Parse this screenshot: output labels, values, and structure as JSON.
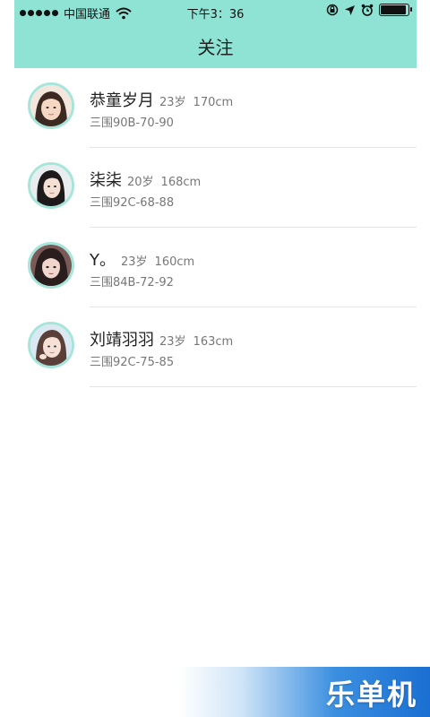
{
  "status_bar": {
    "carrier": "中国联通",
    "time": "下午3：36",
    "battery_level": 0.95
  },
  "header": {
    "title": "关注"
  },
  "follow_list": [
    {
      "name": "恭童岁月",
      "age": "23岁",
      "height": "170cm",
      "measurements": "三围90B-70-90"
    },
    {
      "name": "柒柒",
      "age": "20岁",
      "height": "168cm",
      "measurements": "三围92C-68-88"
    },
    {
      "name": "Y。",
      "age": "23岁",
      "height": "160cm",
      "measurements": "三围84B-72-92"
    },
    {
      "name": "刘靖羽羽",
      "age": "23岁",
      "height": "163cm",
      "measurements": "三围92C-75-85"
    }
  ],
  "watermark": {
    "text": "乐单机"
  },
  "colors": {
    "header_bg": "#8fe3d4",
    "avatar_border": "#a6e6da",
    "divider": "#e4e4e4"
  }
}
